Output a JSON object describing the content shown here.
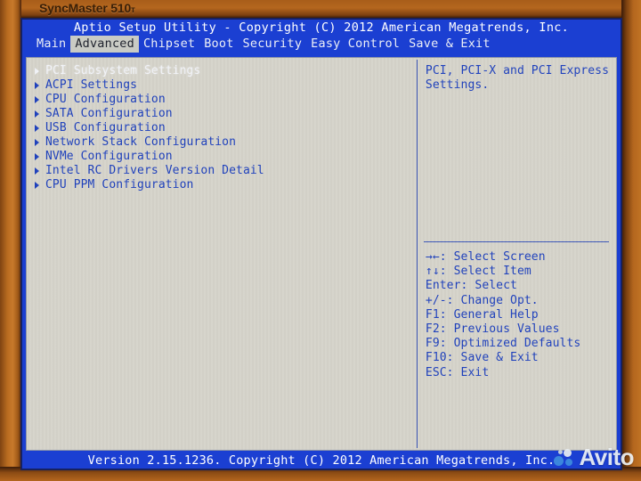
{
  "monitor": {
    "brand_label": "SyncMaster 510",
    "brand_suffix": "т"
  },
  "bios": {
    "title": "Aptio Setup Utility - Copyright (C) 2012 American Megatrends, Inc.",
    "menu_tabs": [
      {
        "label": "Main",
        "active": false
      },
      {
        "label": "Advanced",
        "active": true
      },
      {
        "label": "Chipset",
        "active": false
      },
      {
        "label": "Boot",
        "active": false
      },
      {
        "label": "Security",
        "active": false
      },
      {
        "label": "Easy Control",
        "active": false
      },
      {
        "label": "Save & Exit",
        "active": false
      }
    ],
    "options": [
      {
        "label": "PCI Subsystem Settings",
        "selected": true
      },
      {
        "label": "ACPI Settings",
        "selected": false
      },
      {
        "label": "CPU Configuration",
        "selected": false
      },
      {
        "label": "SATA Configuration",
        "selected": false
      },
      {
        "label": "USB Configuration",
        "selected": false
      },
      {
        "label": "Network Stack Configuration",
        "selected": false
      },
      {
        "label": "NVMe Configuration",
        "selected": false
      },
      {
        "label": "Intel RC Drivers Version Detail",
        "selected": false
      },
      {
        "label": "CPU PPM Configuration",
        "selected": false
      }
    ],
    "help": {
      "line1": "PCI, PCI-X and PCI Express",
      "line2": "Settings."
    },
    "keys": [
      "→←: Select Screen",
      "↑↓: Select Item",
      "Enter: Select",
      "+/-: Change Opt.",
      "F1: General Help",
      "F2: Previous Values",
      "F9: Optimized Defaults",
      "F10: Save & Exit",
      "ESC: Exit"
    ],
    "footer": "Version 2.15.1236. Copyright (C) 2012 American Megatrends, Inc."
  },
  "watermark": {
    "text": "Avito"
  },
  "colors": {
    "bios_blue": "#1b3fd2",
    "panel_bg": "#d7d5cc",
    "text_blue": "#1c3fbe",
    "selected_text": "#f4f6fb",
    "tab_active_bg": "#c9cbc4",
    "bezel_orange": "#b4661e",
    "bezel_dark": "#43200b",
    "watermark_blue": "#3e8ede"
  }
}
